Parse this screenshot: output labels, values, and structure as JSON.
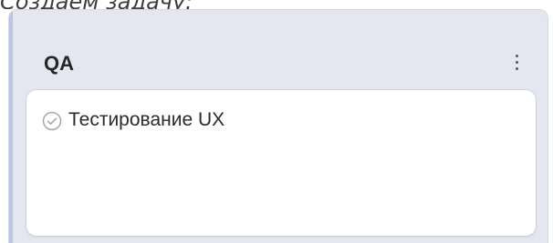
{
  "caption": "Создаем задачу:",
  "column": {
    "title": "QA",
    "menu_icon": "vertical-ellipsis-icon"
  },
  "card": {
    "status_icon": "circle-check-icon",
    "title": "Тестирование UX"
  },
  "colors": {
    "column_background": "#e4e6f0",
    "column_accent": "#b9c6e4",
    "card_background": "#ffffff",
    "check_icon": "#a8a8a8"
  }
}
